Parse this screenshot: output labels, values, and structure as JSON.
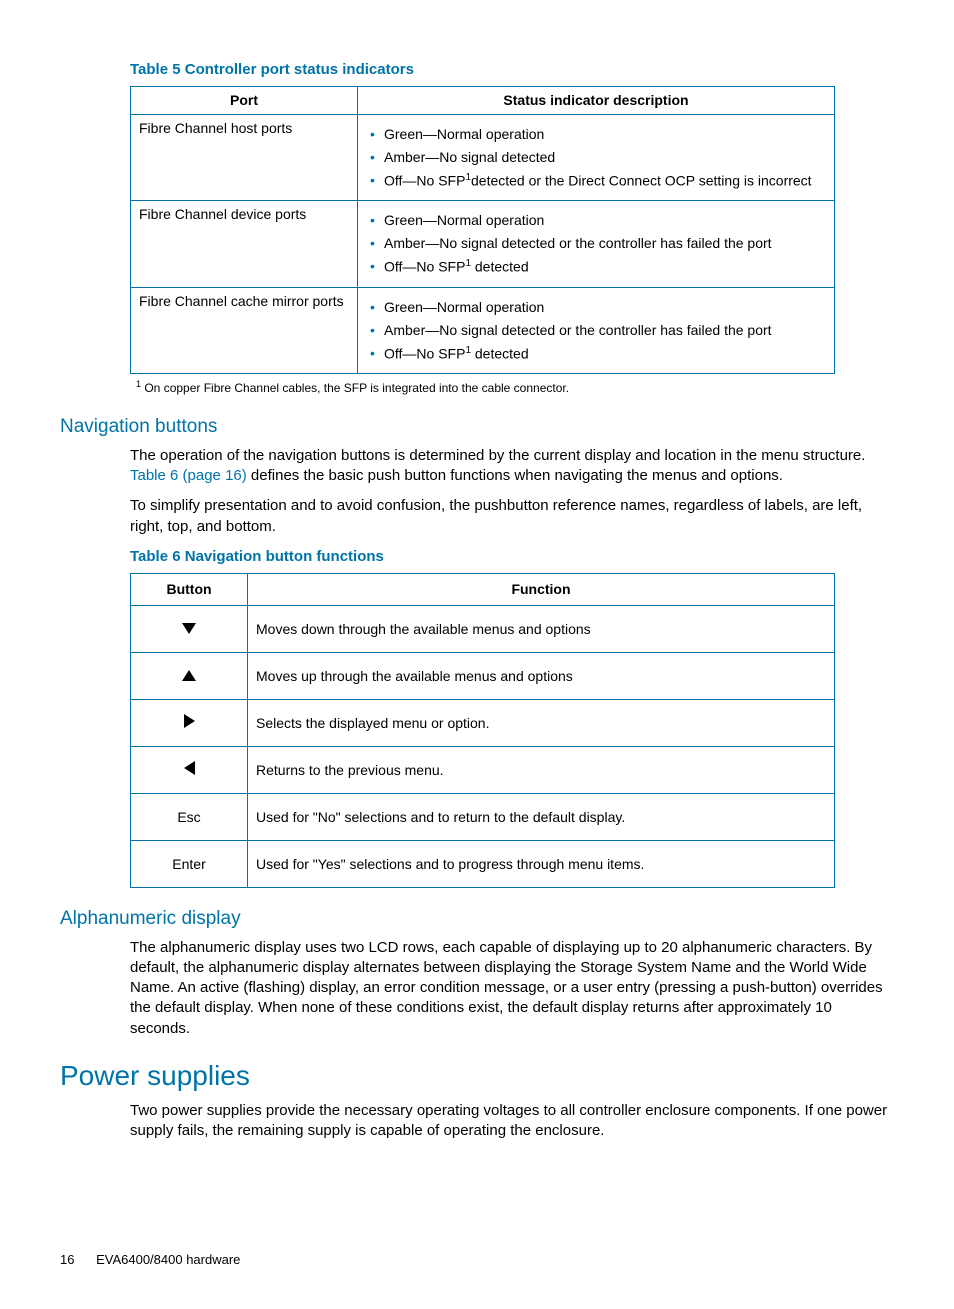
{
  "table5": {
    "caption": "Table 5 Controller port status indicators",
    "headers": [
      "Port",
      "Status indicator description"
    ],
    "rows": [
      {
        "port": "Fibre Channel host ports",
        "items": [
          "Green—Normal operation",
          "Amber—No signal detected",
          "Off—No SFP¹detected or the Direct Connect OCP setting is incorrect"
        ]
      },
      {
        "port": "Fibre Channel device ports",
        "items": [
          "Green—Normal operation",
          "Amber—No signal detected or the controller has failed the port",
          "Off—No SFP¹ detected"
        ]
      },
      {
        "port": "Fibre Channel cache mirror ports",
        "items": [
          "Green—Normal operation",
          "Amber—No signal detected or the controller has failed the port",
          "Off—No SFP¹ detected"
        ]
      }
    ],
    "footnote_num": "1",
    "footnote": " On copper Fibre Channel cables, the SFP is integrated into the cable connector."
  },
  "nav": {
    "heading": "Navigation buttons",
    "p1a": "The operation of the navigation buttons is determined by the current display and location in the menu structure. ",
    "p1link": "Table 6 (page 16)",
    "p1b": " defines the basic push button functions when navigating the menus and options.",
    "p2": "To simplify presentation and to avoid confusion, the pushbutton reference names, regardless of labels, are left, right, top, and bottom."
  },
  "table6": {
    "caption": "Table 6 Navigation button functions",
    "headers": [
      "Button",
      "Function"
    ],
    "rows": [
      {
        "icon": "down",
        "label": "",
        "func": "Moves down through the available menus and options"
      },
      {
        "icon": "up",
        "label": "",
        "func": "Moves up through the available menus and options"
      },
      {
        "icon": "right",
        "label": "",
        "func": "Selects the displayed menu or option."
      },
      {
        "icon": "left",
        "label": "",
        "func": "Returns to the previous menu."
      },
      {
        "icon": "",
        "label": "Esc",
        "func": "Used for \"No\" selections and to return to the default display."
      },
      {
        "icon": "",
        "label": "Enter",
        "func": "Used for \"Yes\" selections and to progress through menu items."
      }
    ]
  },
  "alpha": {
    "heading": "Alphanumeric display",
    "p": "The alphanumeric display uses two LCD rows, each capable of displaying up to 20 alphanumeric characters. By default, the alphanumeric display alternates between displaying the Storage System Name and the World Wide Name. An active (flashing) display, an error condition message, or a user entry (pressing a push-button) overrides the default display. When none of these conditions exist, the default display returns after approximately 10 seconds."
  },
  "power": {
    "heading": "Power supplies",
    "p": "Two power supplies provide the necessary operating voltages to all controller enclosure components. If one power supply fails, the remaining supply is capable of operating the enclosure."
  },
  "footer": {
    "page": "16",
    "title": "EVA6400/8400 hardware"
  }
}
